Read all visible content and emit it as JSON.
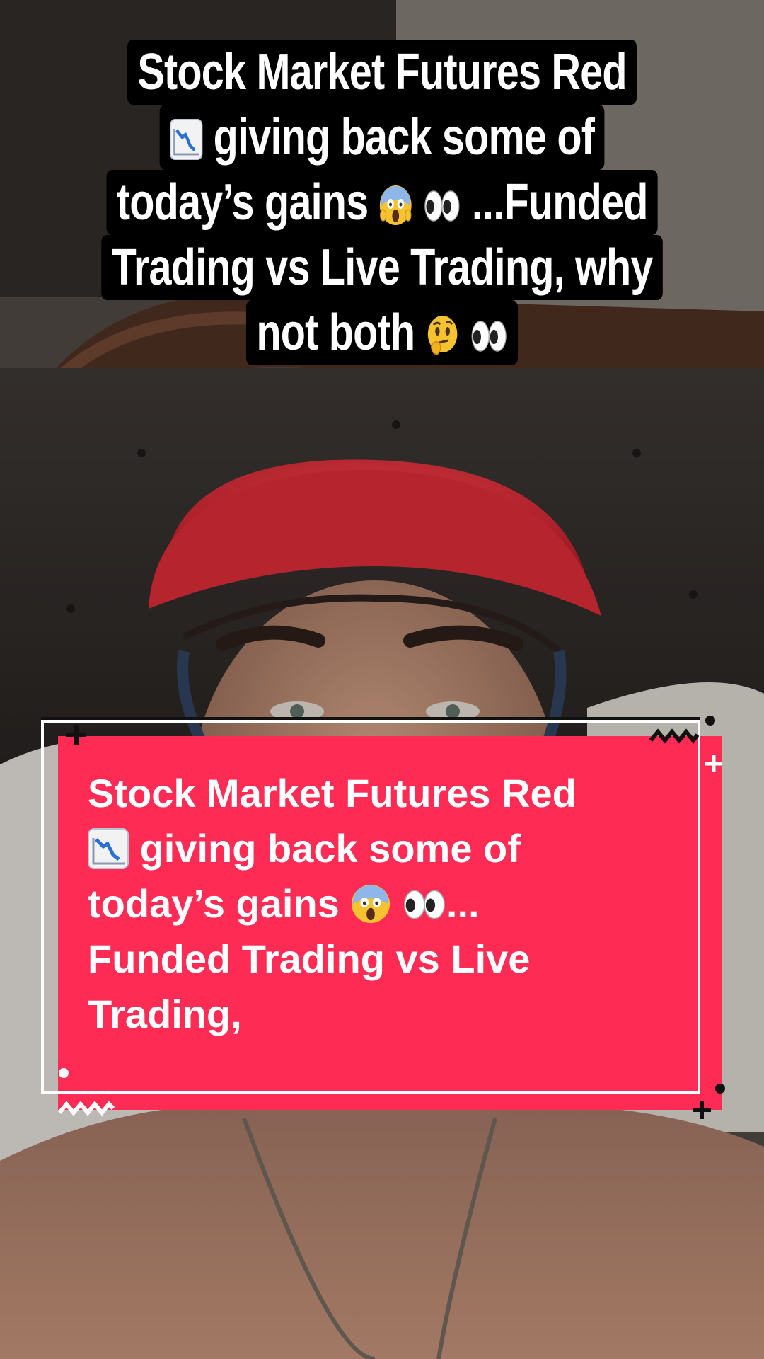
{
  "overlay_top": {
    "lines": [
      "Stock Market Futures Red",
      "giving  back some of",
      "today’s gains",
      "...Funded",
      "Trading vs Live Trading, why",
      "not both"
    ],
    "box_color": "#000000",
    "text_color": "#ffffff"
  },
  "caption_card": {
    "lines": [
      "Stock Market Futures Red",
      "giving  back some of",
      "today’s gains",
      "...",
      "Funded Trading vs Live",
      "Trading,"
    ],
    "card_color": "#fe2c55",
    "text_color": "#ffffff"
  },
  "icons": [
    "chart-decreasing-emoji",
    "screaming-face-emoji",
    "eyes-emoji",
    "thinking-face-emoji"
  ]
}
